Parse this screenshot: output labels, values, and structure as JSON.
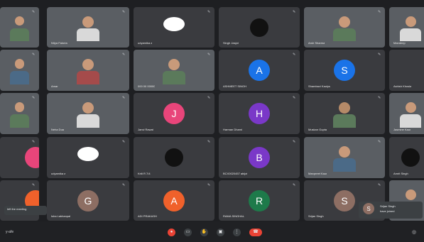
{
  "colors": {
    "background": "#1e1f22",
    "tile": "#3a3b3f",
    "blue_avatar": "#1a73e8",
    "pink_avatar": "#e8457a",
    "purple_avatar": "#7a38c8",
    "orange_avatar": "#f0612b",
    "green_avatar": "#1e7a4a",
    "brown_avatar": "#8d6e63",
    "end_call": "#ea4335"
  },
  "tiles": [
    {
      "id": "r1c1",
      "name": "",
      "initial": "",
      "kind": "video"
    },
    {
      "id": "r1c2",
      "name": "Nitya Fatoria",
      "initial": "",
      "kind": "video"
    },
    {
      "id": "r1c3",
      "name": "udyamika a",
      "initial": "",
      "kind": "logo"
    },
    {
      "id": "r1c4",
      "name": "Singh Jasjot",
      "initial": "",
      "kind": "logo-dark"
    },
    {
      "id": "r1c5",
      "name": "Arsh Sharma",
      "initial": "",
      "kind": "video"
    },
    {
      "id": "r1c6",
      "name": "Mandeep",
      "initial": "",
      "kind": "video"
    },
    {
      "id": "r2c1",
      "name": "",
      "initial": "",
      "kind": "video"
    },
    {
      "id": "r2c2",
      "name": "Amar",
      "initial": "",
      "kind": "video"
    },
    {
      "id": "r2c3",
      "name": "000 00 00000",
      "initial": "",
      "kind": "video"
    },
    {
      "id": "r2c4",
      "name": "ASHMEET SINGH",
      "initial": "A",
      "kind": "avatar",
      "color": "#1a73e8"
    },
    {
      "id": "r2c5",
      "name": "Shambavi Kaulys",
      "initial": "S",
      "kind": "avatar",
      "color": "#1a73e8"
    },
    {
      "id": "r2c6",
      "name": "Ashish Khosla",
      "initial": "",
      "kind": "dark"
    },
    {
      "id": "r3c1",
      "name": "",
      "initial": "",
      "kind": "video"
    },
    {
      "id": "r3c2",
      "name": "Neha Dua",
      "initial": "",
      "kind": "video"
    },
    {
      "id": "r3c3",
      "name": "Janvi Rawat",
      "initial": "J",
      "kind": "avatar",
      "color": "#e8457a"
    },
    {
      "id": "r3c4",
      "name": "Harman Dhami",
      "initial": "H",
      "kind": "avatar",
      "color": "#7a38c8"
    },
    {
      "id": "r3c5",
      "name": "Muskan Gupta",
      "initial": "",
      "kind": "photo-round"
    },
    {
      "id": "r3c6",
      "name": "Jasmine Kaur",
      "initial": "",
      "kind": "video"
    },
    {
      "id": "r4c1",
      "name": "",
      "initial": "",
      "kind": "pink-edge"
    },
    {
      "id": "r4c2",
      "name": "udyamika a",
      "initial": "",
      "kind": "logo"
    },
    {
      "id": "r4c3",
      "name": "Kriti R 7/4",
      "initial": "",
      "kind": "logo-dark"
    },
    {
      "id": "r4c4",
      "name": "BCX0020457 abijot",
      "initial": "B",
      "kind": "avatar",
      "color": "#7a38c8"
    },
    {
      "id": "r4c5",
      "name": "Manpreet Kaur",
      "initial": "",
      "kind": "video"
    },
    {
      "id": "r4c6",
      "name": "Amrit Singh",
      "initial": "",
      "kind": "logo-dark-small"
    },
    {
      "id": "r5c1",
      "name": "",
      "initial": "",
      "kind": "orange-edge"
    },
    {
      "id": "r5c2",
      "name": "Isha Lakhanpal",
      "initial": "G",
      "kind": "avatar",
      "color": "#8d6e63"
    },
    {
      "id": "r5c3",
      "name": "ADI PRAKASH",
      "initial": "A",
      "kind": "avatar",
      "color": "#f0612b"
    },
    {
      "id": "r5c4",
      "name": "RAMA SINGHAL",
      "initial": "R",
      "kind": "avatar",
      "color": "#1e7a4a"
    },
    {
      "id": "r5c5",
      "name": "Srijan Singh",
      "initial": "S",
      "kind": "avatar",
      "color": "#8d6e63"
    },
    {
      "id": "r5c6",
      "name": "",
      "initial": "",
      "kind": "video"
    }
  ],
  "toasts": {
    "left": "left the meeting",
    "right_title": "Srijan Singh",
    "right_sub": "have joined",
    "right_initial": "S"
  },
  "bottombar": {
    "left_label": "y-afe",
    "controls": [
      "mic",
      "camera",
      "hand",
      "present",
      "more",
      "end"
    ]
  }
}
